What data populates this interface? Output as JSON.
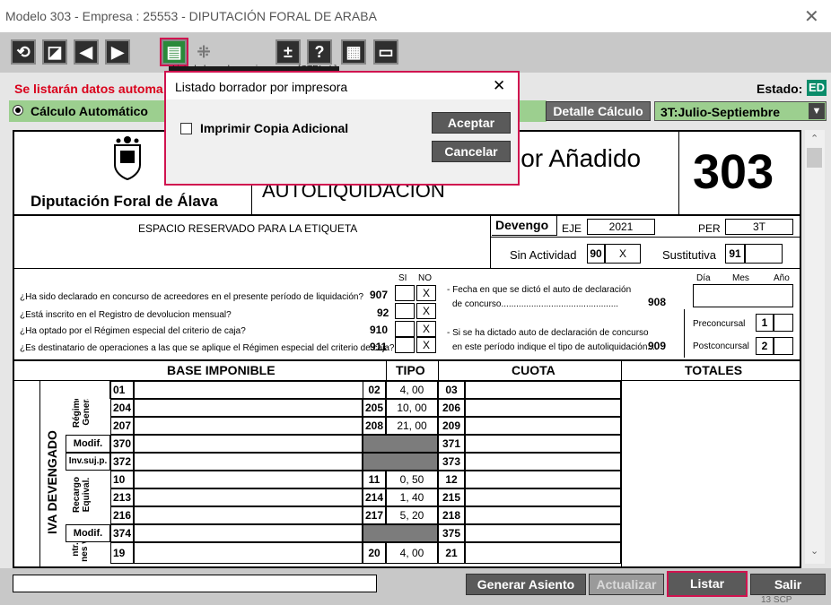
{
  "window": {
    "title": "Modelo 303 - Empresa : 25553 - DIPUTACIÓN FORAL DE ARABA",
    "close_glyph": "✕"
  },
  "toolbar": {
    "tooltip": "Listado borrador por impresora [CTRL+L]"
  },
  "bar1": {
    "notice": "Se listarán datos automa",
    "estado_label": "Estado:",
    "estado_value": "ED"
  },
  "bar2": {
    "calc_label": "Cálculo Automático",
    "detalle_btn": "Detalle Cálculo",
    "period_select": "3T:Julio-Septiembre"
  },
  "header": {
    "org": "Diputación Foral de Álava",
    "title_partial": "lor Añadido",
    "subtitle": "AUTOLIQUIDACIÓN",
    "model": "303"
  },
  "etiqueta": {
    "label": "ESPACIO RESERVADO PARA LA ETIQUETA",
    "devengo": "Devengo",
    "eje_label": "EJE",
    "eje_value": "2021",
    "per_label": "PER",
    "per_value": "3T",
    "sin_act": "Sin Actividad",
    "sin_code": "90",
    "sin_val": "X",
    "sust": "Sustitutiva",
    "sust_code": "91"
  },
  "questions": {
    "si": "SI",
    "no": "NO",
    "items": [
      {
        "text": "¿Ha sido declarado en concurso de acreedores en el presente período de liquidación?",
        "code": "907",
        "no": "X"
      },
      {
        "text": "¿Está inscrito en el Registro de devolucion mensual?",
        "code": "92",
        "no": "X"
      },
      {
        "text": "¿Ha optado por el Régimen especial del criterio de caja?",
        "code": "910",
        "no": "X"
      },
      {
        "text": "¿Es destinatario de operaciones a las que se aplique el Régimen especial del criterio de caja?",
        "code": "911",
        "no": "X"
      }
    ],
    "fecha1": "- Fecha en que se dictó el auto de declaración",
    "fecha2": "de concurso...............................................",
    "fecha_code": "908",
    "dia": "Día",
    "mes": "Mes",
    "anio": "Año",
    "auto1": "- Si se ha dictado auto de declaración de concurso",
    "auto2": "en este período indique el tipo de autoliquidación....",
    "auto_code": "909",
    "pre": "Preconcursal",
    "pre_val": "1",
    "post": "Postconcursal",
    "post_val": "2"
  },
  "table": {
    "h_base": "BASE IMPONIBLE",
    "h_tipo": "TIPO",
    "h_cuota": "CUOTA",
    "h_totales": "TOTALES",
    "side": "IVA DEVENGADO",
    "g1": "Régimen General",
    "g2": "Recargo Equival.",
    "g3": "ntr. nes v.",
    "rows": [
      {
        "label": "",
        "base": "01",
        "tcode": "02",
        "tipo": "4, 00",
        "cuota": "03"
      },
      {
        "label": "",
        "base": "204",
        "tcode": "205",
        "tipo": "10, 00",
        "cuota": "206"
      },
      {
        "label": "",
        "base": "207",
        "tcode": "208",
        "tipo": "21, 00",
        "cuota": "209"
      },
      {
        "label": "Modif.",
        "base": "370",
        "tcode": "",
        "tipo": "",
        "cuota": "371"
      },
      {
        "label": "Inv.suj.p.",
        "base": "372",
        "tcode": "",
        "tipo": "",
        "cuota": "373"
      },
      {
        "label": "",
        "base": "10",
        "tcode": "11",
        "tipo": "0, 50",
        "cuota": "12"
      },
      {
        "label": "",
        "base": "213",
        "tcode": "214",
        "tipo": "1, 40",
        "cuota": "215"
      },
      {
        "label": "",
        "base": "216",
        "tcode": "217",
        "tipo": "5, 20",
        "cuota": "218"
      },
      {
        "label": "Modif.",
        "base": "374",
        "tcode": "",
        "tipo": "",
        "cuota": "375"
      },
      {
        "label": "",
        "base": "19",
        "tcode": "20",
        "tipo": "4, 00",
        "cuota": "21"
      }
    ]
  },
  "footer": {
    "generar": "Generar Asiento",
    "actualizar": "Actualizar",
    "listar": "Listar",
    "salir": "Salir",
    "corner": "13 SCP"
  },
  "dialog": {
    "title": "Listado borrador por impresora",
    "close": "✕",
    "checkbox": "Imprimir Copia Adicional",
    "aceptar": "Aceptar",
    "cancelar": "Cancelar"
  }
}
